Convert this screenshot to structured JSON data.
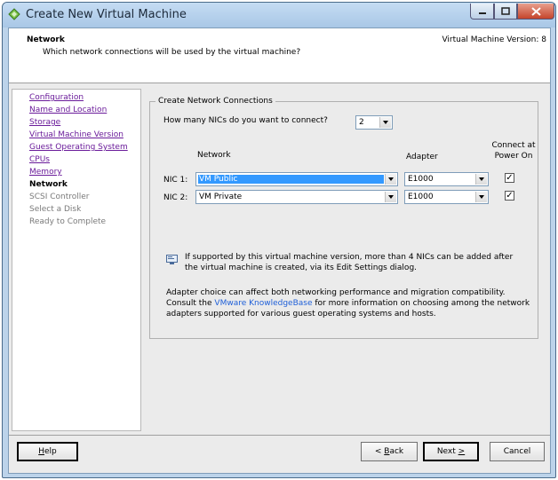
{
  "window": {
    "title": "Create New Virtual Machine"
  },
  "header": {
    "title": "Network",
    "subtitle": "Which network connections will be used by the virtual machine?",
    "version": "Virtual Machine Version: 8"
  },
  "nav": {
    "completed": [
      "Configuration",
      "Name and Location",
      "Storage",
      "Virtual Machine Version",
      "Guest Operating System",
      "CPUs",
      "Memory"
    ],
    "current": "Network",
    "pending": [
      "SCSI Controller",
      "Select a Disk",
      "Ready to Complete"
    ]
  },
  "network": {
    "group_label": "Create Network Connections",
    "nic_count_question": "How many NICs do you want to connect?",
    "nic_count_value": "2",
    "col_network": "Network",
    "col_adapter": "Adapter",
    "col_connect": "Connect at Power On",
    "nics": [
      {
        "label": "NIC 1:",
        "network": "VM Public",
        "adapter": "E1000",
        "connected": true
      },
      {
        "label": "NIC 2:",
        "network": "VM Private",
        "adapter": "E1000",
        "connected": true
      }
    ],
    "info": "If supported by this virtual machine version, more than 4 NICs can be added after the virtual machine is created, via its Edit Settings dialog.",
    "note_before": "Adapter choice can affect both networking performance and migration compatibility. Consult the ",
    "note_link": "VMware KnowledgeBase",
    "note_after": " for more information on choosing among the network adapters supported for various guest operating systems and hosts."
  },
  "buttons": {
    "help_pre": "",
    "help_key": "H",
    "help_post": "elp",
    "back_pre": "< ",
    "back_key": "B",
    "back_post": "ack",
    "next_pre": "Next ",
    "next_key": ">",
    "next_post": "",
    "cancel": "Cancel"
  },
  "colors": {
    "link_visited": "#6a1b9a",
    "link": "#1e5fd8",
    "selection": "#3399ff"
  }
}
